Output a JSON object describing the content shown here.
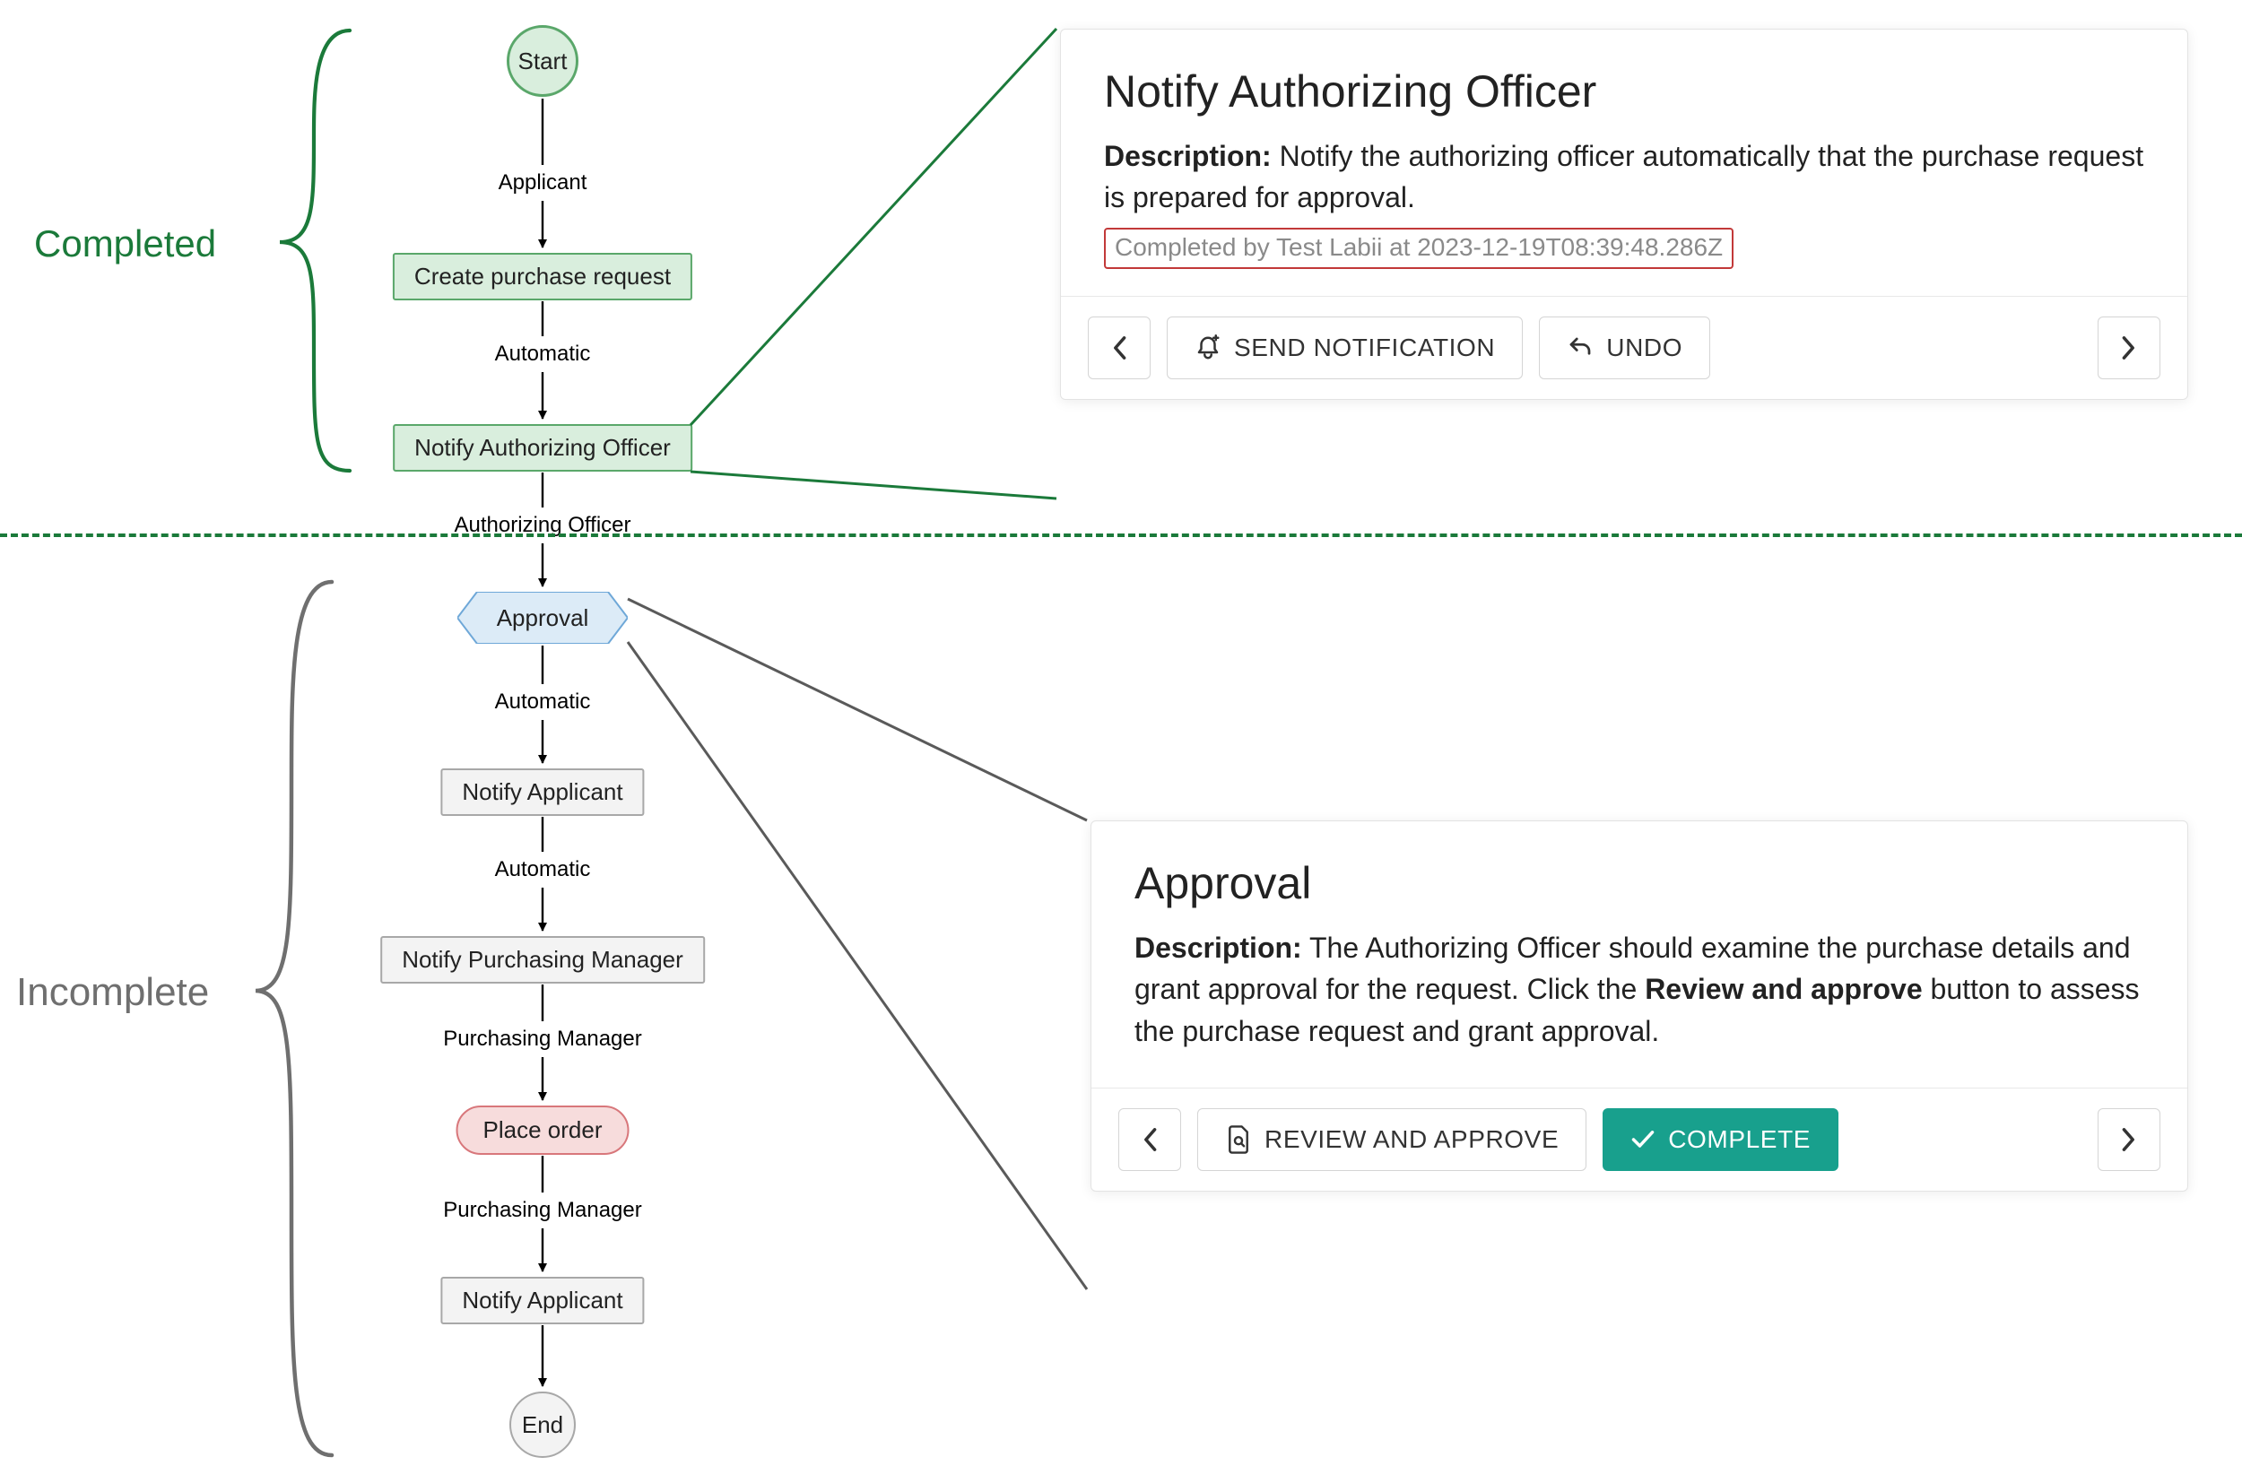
{
  "sections": {
    "completed_label": "Completed",
    "incomplete_label": "Incomplete"
  },
  "flow": {
    "start": "Start",
    "end": "End",
    "nodes": {
      "create_purchase_request": "Create purchase request",
      "notify_authorizing_officer": "Notify Authorizing Officer",
      "approval": "Approval",
      "notify_applicant": "Notify Applicant",
      "notify_purchasing_manager": "Notify Purchasing Manager",
      "place_order": "Place order"
    },
    "edges": {
      "applicant": "Applicant",
      "automatic": "Automatic",
      "authorizing_officer": "Authorizing Officer",
      "purchasing_manager": "Purchasing Manager"
    }
  },
  "panel_notify": {
    "title": "Notify Authorizing Officer",
    "description_label": "Description:",
    "description_text": "Notify the authorizing officer automatically that the purchase request is prepared for approval.",
    "completion_text": "Completed by Test Labii at 2023-12-19T08:39:48.286Z",
    "buttons": {
      "send_notification": "SEND NOTIFICATION",
      "undo": "UNDO"
    }
  },
  "panel_approval": {
    "title": "Approval",
    "description_label": "Description:",
    "description_text_a": "The Authorizing Officer should examine the purchase details and grant approval for the request. Click the ",
    "description_bold": "Review and approve",
    "description_text_b": " button to assess the purchase request and grant approval.",
    "buttons": {
      "review_and_approve": "REVIEW AND APPROVE",
      "complete": "COMPLETE"
    }
  },
  "colors": {
    "green_dark": "#1b7a3a",
    "teal": "#18a08d",
    "callout_red": "#c23939"
  }
}
